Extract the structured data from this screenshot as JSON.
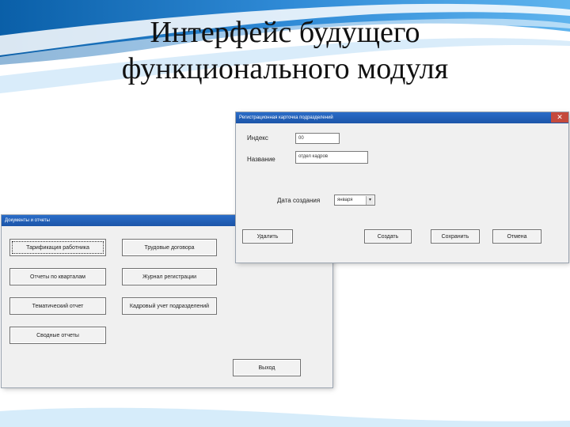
{
  "slide": {
    "title_line1": "Интерфейс будущего",
    "title_line2": "функционального модуля"
  },
  "window_docs": {
    "title": "Документы и отчеты",
    "buttons": [
      "Тарификация работника",
      "Трудовые договора",
      "Отчеты по кварталам",
      "Журнал регистрации",
      "Тематический отчет",
      "Кадровый учет подразделений",
      "Сводные отчеты"
    ],
    "exit_button": "Выход"
  },
  "window_unit": {
    "title": "Регистрационная карточка подразделений",
    "close_glyph": "✕",
    "index_label": "Индекс",
    "index_value": "00",
    "name_label": "Название",
    "name_value": "отдел кадров",
    "date_label": "Дата создания",
    "date_value": "января",
    "combo_arrow": "▾",
    "buttons": [
      "Удалить",
      "Создать",
      "Сохранить",
      "Отмена"
    ]
  },
  "colors": {
    "titlebar": "#1f5fb4",
    "close": "#c54a3c",
    "window_bg": "#f0f0f0"
  }
}
